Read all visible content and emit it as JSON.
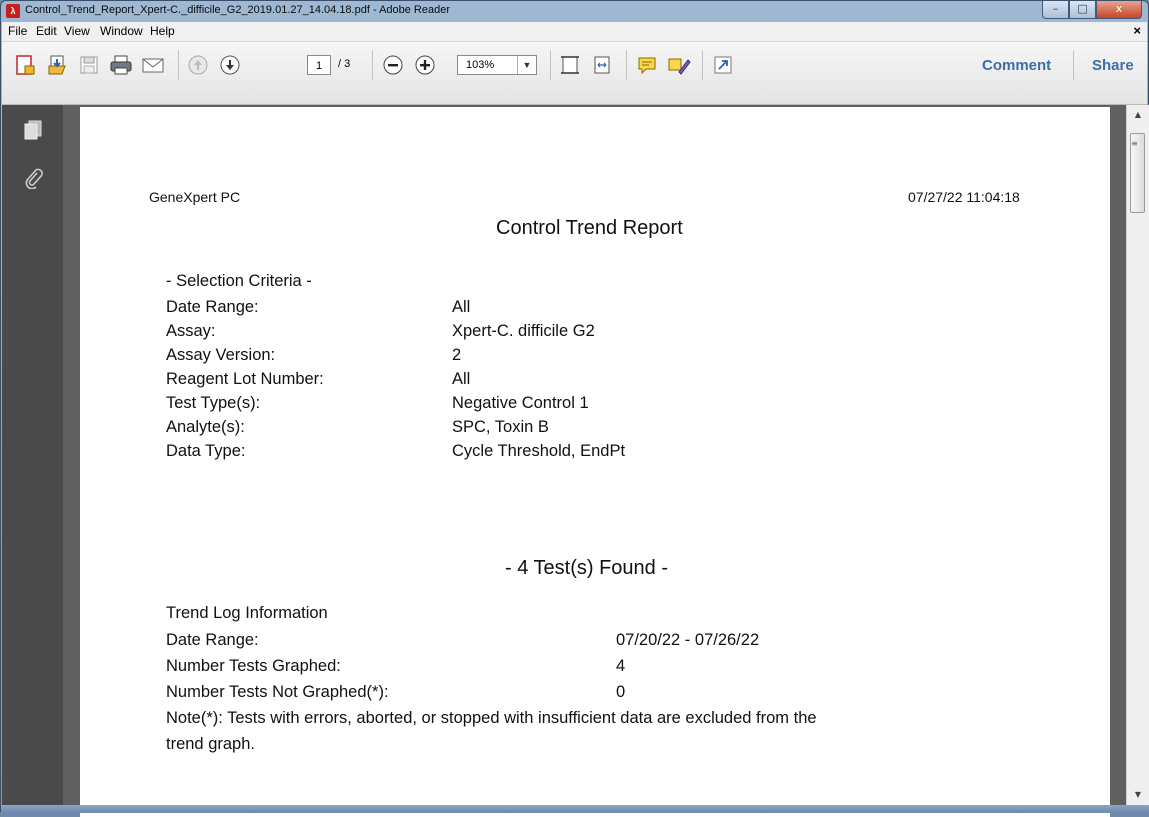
{
  "window": {
    "title": "Control_Trend_Report_Xpert-C._difficile_G2_2019.01.27_14.04.18.pdf - Adobe Reader",
    "minimize": "–",
    "maximize": "□",
    "close": "x"
  },
  "menubar": {
    "items": [
      "File",
      "Edit",
      "View",
      "Window",
      "Help"
    ],
    "close": "×"
  },
  "toolbar": {
    "page_current": "1",
    "page_total": "/ 3",
    "zoom": "103%",
    "comment": "Comment",
    "share": "Share"
  },
  "report": {
    "system": "GeneXpert PC",
    "timestamp": "07/27/22 11:04:18",
    "title": "Control Trend Report",
    "selection_heading": "- Selection Criteria -",
    "criteria": [
      {
        "label": "Date Range:",
        "value": "All"
      },
      {
        "label": "Assay:",
        "value": "Xpert-C. difficile G2"
      },
      {
        "label": "Assay Version:",
        "value": "2"
      },
      {
        "label": "Reagent Lot Number:",
        "value": "All"
      },
      {
        "label": "Test Type(s):",
        "value": "Negative Control 1"
      },
      {
        "label": "Analyte(s):",
        "value": "SPC, Toxin B"
      },
      {
        "label": "Data Type:",
        "value": "Cycle Threshold, EndPt"
      }
    ],
    "tests_found": "- 4 Test(s) Found -",
    "trend_heading": "Trend Log Information",
    "trend": [
      {
        "label": "Date Range:",
        "value": "07/20/22 - 07/26/22"
      },
      {
        "label": "Number Tests Graphed:",
        "value": "4"
      },
      {
        "label": "Number Tests Not Graphed(*):",
        "value": "0"
      }
    ],
    "note_line1": "Note(*): Tests with errors, aborted, or stopped with insufficient data are excluded from the",
    "note_line2": "trend graph."
  }
}
